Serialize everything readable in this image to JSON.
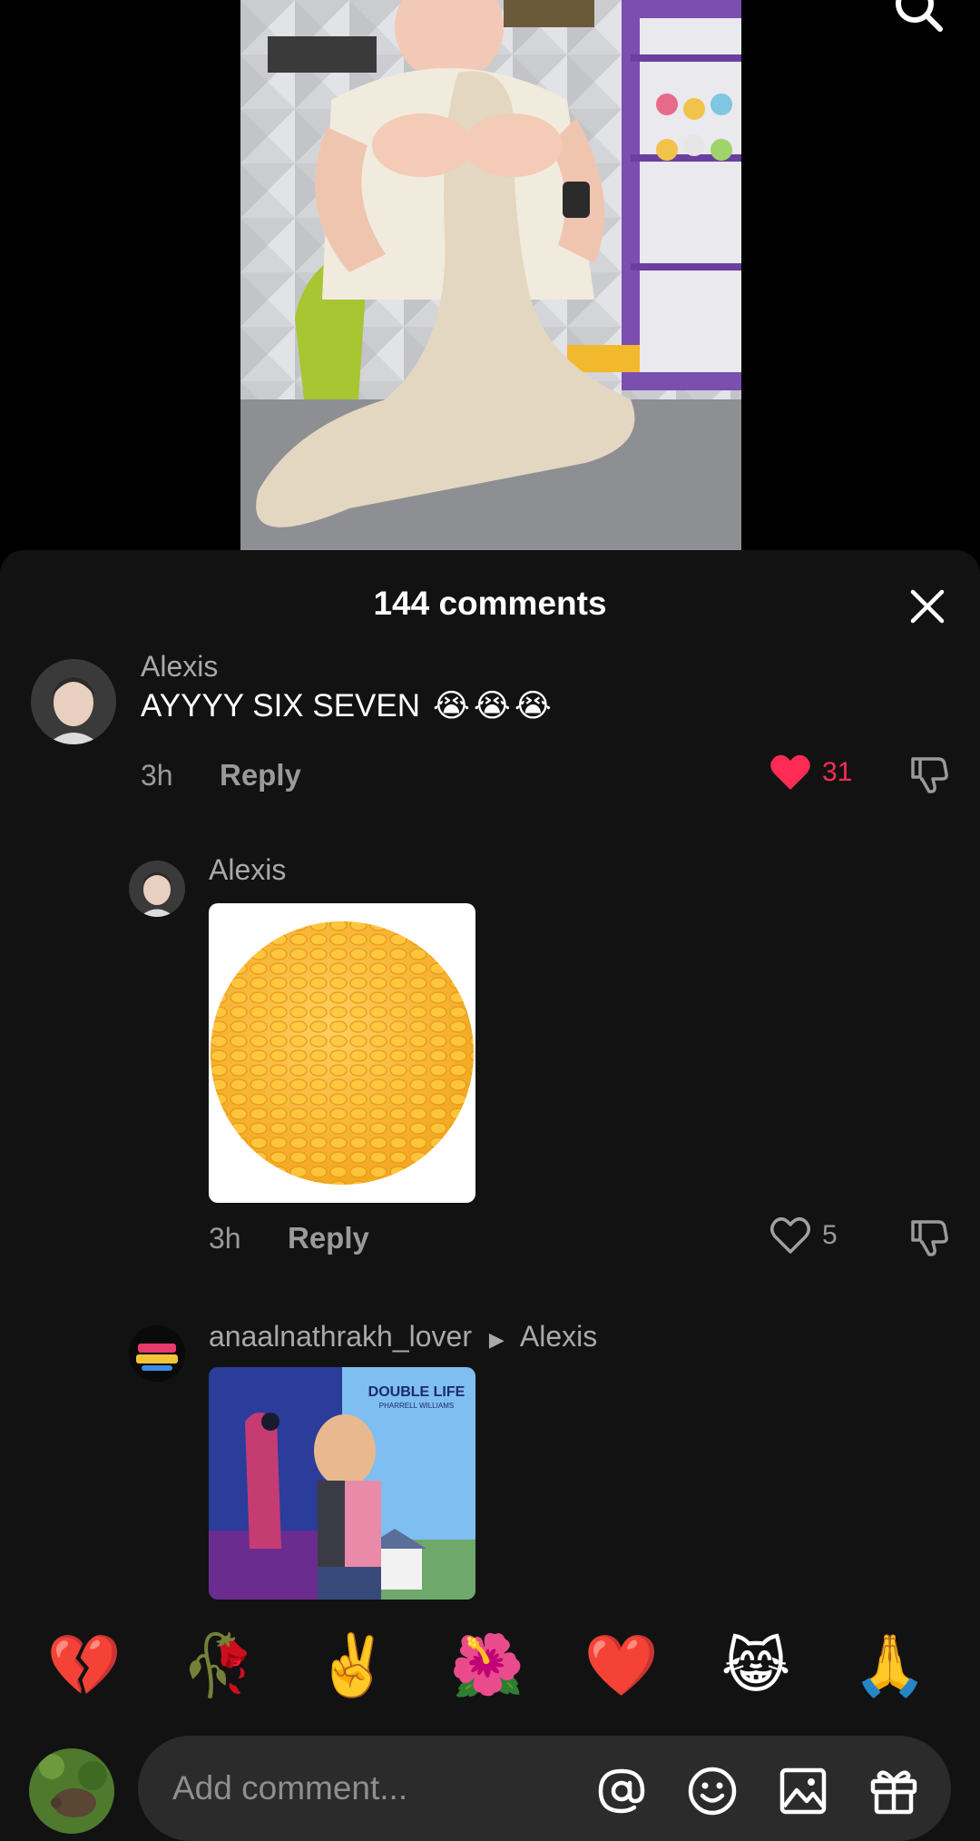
{
  "video": {
    "search_icon": "search-icon"
  },
  "comments_sheet": {
    "title": "144 comments",
    "close_icon": "close-icon",
    "comments": [
      {
        "username": "Alexis",
        "text": "AYYYY SIX SEVEN",
        "emojis": [
          "😭",
          "😭",
          "😭"
        ],
        "time": "3h",
        "reply_label": "Reply",
        "likes": "31",
        "liked": true
      },
      {
        "username": "Alexis",
        "image": "yellow corn-textured ball",
        "time": "3h",
        "reply_label": "Reply",
        "likes": "5",
        "liked": false
      },
      {
        "username": "anaalnathrakh_lover",
        "reply_to": "Alexis",
        "image": "movie poster",
        "image_text_title": "DOUBLE LIFE",
        "image_text_sub": "PHARRELL WILLIAMS"
      }
    ]
  },
  "emoji_bar": [
    "💔",
    "🥀",
    "✌️",
    "🌺",
    "❤️",
    "😹",
    "🙏"
  ],
  "composer": {
    "placeholder": "Add comment...",
    "icons": [
      "at-icon",
      "emoji-icon",
      "image-icon",
      "gift-icon"
    ]
  },
  "colors": {
    "accent": "#fe2c55",
    "sheet_bg": "#121212",
    "input_bg": "#2b2b2b"
  }
}
